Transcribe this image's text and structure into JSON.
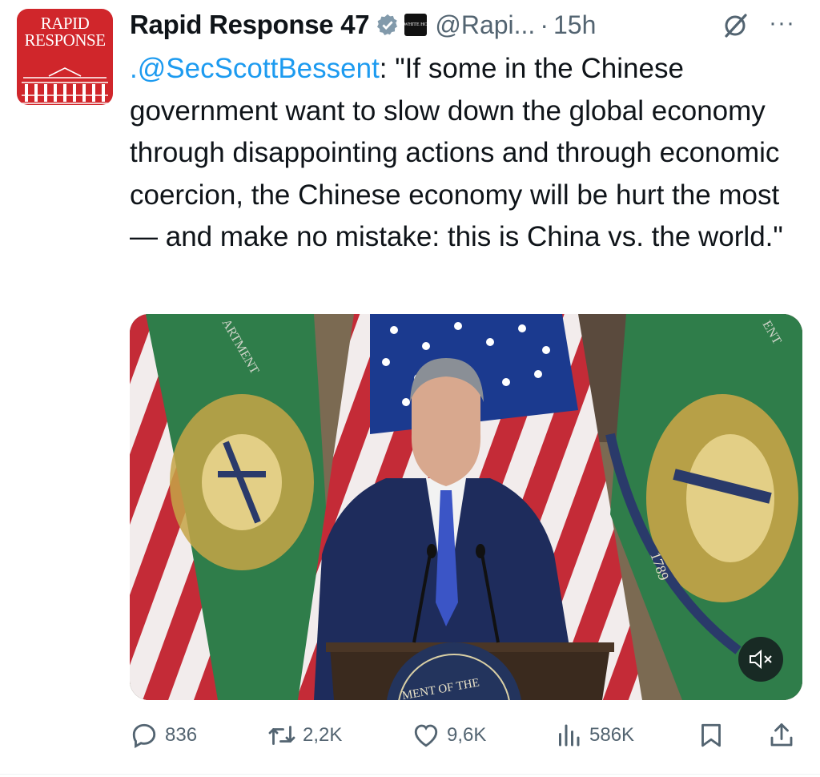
{
  "avatar": {
    "brand_line1": "RAPID",
    "brand_line2": "RESPONSE",
    "color": "#d0262b"
  },
  "header": {
    "display_name": "Rapid Response 47",
    "affiliation_badge": "The WHITE HOUSE",
    "handle": "@Rapi...",
    "separator": "·",
    "time": "15h",
    "more_label": "···"
  },
  "tweet": {
    "mention": ".@SecScottBessent",
    "text": ": \"If some in the Chinese government want to slow down the global economy through disappointing actions and through economic coercion, the Chinese economy will be hurt the most — and make no mistake: this is China vs. the world.\""
  },
  "media": {
    "podium_seal_text": "MENT OF THE",
    "flag_seal_year": "1789",
    "flag_scroll_left": "ARTMENT",
    "flag_scroll_right": "ENT",
    "mute_icon": "speaker-muted-icon"
  },
  "actions": {
    "replies": "836",
    "reposts": "2,2K",
    "likes": "9,6K",
    "views": "586K"
  },
  "colors": {
    "accent": "#1d9bf0",
    "muted_text": "#536471",
    "text": "#0f1419"
  }
}
